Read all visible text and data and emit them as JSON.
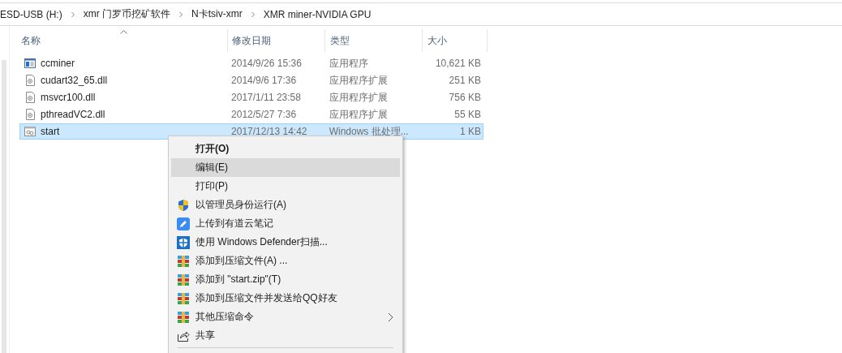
{
  "breadcrumb": [
    "ESD-USB (H:)",
    "xmr 门罗币挖矿软件",
    "N卡tsiv-xmr",
    "XMR miner-NVIDIA GPU"
  ],
  "columns": [
    {
      "label": "名称",
      "sorted": true
    },
    {
      "label": "修改日期",
      "sorted": false
    },
    {
      "label": "类型",
      "sorted": false
    },
    {
      "label": "大小",
      "sorted": false
    }
  ],
  "files": [
    {
      "name": "ccminer",
      "modified": "2014/9/26 15:36",
      "type": "应用程序",
      "size": "10,621 KB",
      "kind": "app",
      "selected": false
    },
    {
      "name": "cudart32_65.dll",
      "modified": "2014/9/6 17:36",
      "type": "应用程序扩展",
      "size": "251 KB",
      "kind": "dll",
      "selected": false
    },
    {
      "name": "msvcr100.dll",
      "modified": "2017/1/11 23:58",
      "type": "应用程序扩展",
      "size": "756 KB",
      "kind": "dll",
      "selected": false
    },
    {
      "name": "pthreadVC2.dll",
      "modified": "2012/5/27 7:36",
      "type": "应用程序扩展",
      "size": "55 KB",
      "kind": "dll",
      "selected": false
    },
    {
      "name": "start",
      "modified": "2017/12/13 14:42",
      "type": "Windows 批处理...",
      "size": "1 KB",
      "kind": "batch",
      "selected": true
    }
  ],
  "context_menu": {
    "items": [
      {
        "label": "打开(O)",
        "kind": "plain",
        "bold": true,
        "selected": false,
        "submenu": false
      },
      {
        "label": "编辑(E)",
        "kind": "plain",
        "bold": false,
        "selected": true,
        "submenu": false
      },
      {
        "label": "打印(P)",
        "kind": "plain",
        "bold": false,
        "selected": false,
        "submenu": false
      },
      {
        "label": "以管理员身份运行(A)",
        "kind": "uac",
        "bold": false,
        "selected": false,
        "submenu": false
      },
      {
        "label": "上传到有道云笔记",
        "kind": "note",
        "bold": false,
        "selected": false,
        "submenu": false
      },
      {
        "label": "使用 Windows Defender扫描...",
        "kind": "defender",
        "bold": false,
        "selected": false,
        "submenu": false
      },
      {
        "label": "添加到压缩文件(A) ...",
        "kind": "archive",
        "bold": false,
        "selected": false,
        "submenu": false
      },
      {
        "label": "添加到 \"start.zip\"(T)",
        "kind": "archive",
        "bold": false,
        "selected": false,
        "submenu": false
      },
      {
        "label": "添加到压缩文件并发送给QQ好友",
        "kind": "archive",
        "bold": false,
        "selected": false,
        "submenu": false
      },
      {
        "label": "其他压缩命令",
        "kind": "archive",
        "bold": false,
        "selected": false,
        "submenu": true
      },
      {
        "label": "共享",
        "kind": "share",
        "bold": false,
        "selected": false,
        "submenu": false
      }
    ]
  }
}
